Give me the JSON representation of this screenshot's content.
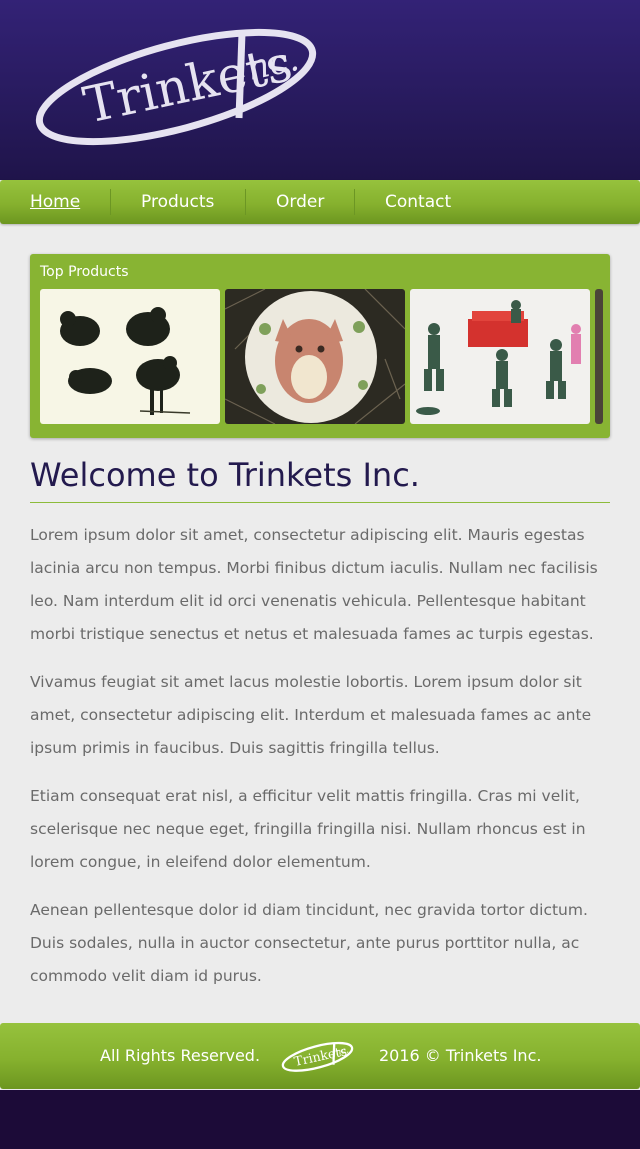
{
  "brand": {
    "logo_text": "Trinkets Inc."
  },
  "nav": {
    "items": [
      {
        "label": "Home",
        "active": true
      },
      {
        "label": "Products",
        "active": false
      },
      {
        "label": "Order",
        "active": false
      },
      {
        "label": "Contact",
        "active": false
      }
    ]
  },
  "top_products": {
    "title": "Top Products",
    "images": [
      {
        "alt": "black toy soldier figures"
      },
      {
        "alt": "felt ornament with fox"
      },
      {
        "alt": "green army men figures"
      }
    ]
  },
  "main": {
    "heading": "Welcome to Trinkets Inc.",
    "paragraphs": [
      "Lorem ipsum dolor sit amet, consectetur adipiscing elit. Mauris egestas lacinia arcu non tempus. Morbi finibus dictum iaculis. Nullam nec facilisis leo. Nam interdum elit id orci venenatis vehicula. Pellentesque habitant morbi tristique senectus et netus et malesuada fames ac turpis egestas.",
      "Vivamus feugiat sit amet lacus molestie lobortis. Lorem ipsum dolor sit amet, consectetur adipiscing elit. Interdum et malesuada fames ac ante ipsum primis in faucibus. Duis sagittis fringilla tellus.",
      "Etiam consequat erat nisl, a efficitur velit mattis fringilla. Cras mi velit, scelerisque nec neque eget, fringilla fringilla nisi. Nullam rhoncus est in lorem congue, in eleifend dolor elementum.",
      "Aenean pellentesque dolor id diam tincidunt, nec gravida tortor dictum. Duis sodales, nulla in auctor consectetur, ante purus porttitor nulla, ac commodo velit diam id purus."
    ]
  },
  "footer": {
    "left_text": "All Rights Reserved.",
    "right_text": "2016 © Trinkets Inc."
  },
  "colors": {
    "header_bg": "#2a1c64",
    "nav_green": "#8ab935",
    "heading": "#231a4e",
    "body_text": "#6a6a6a",
    "page_bg": "#ececec",
    "bottom_bar": "#1c0b38"
  }
}
